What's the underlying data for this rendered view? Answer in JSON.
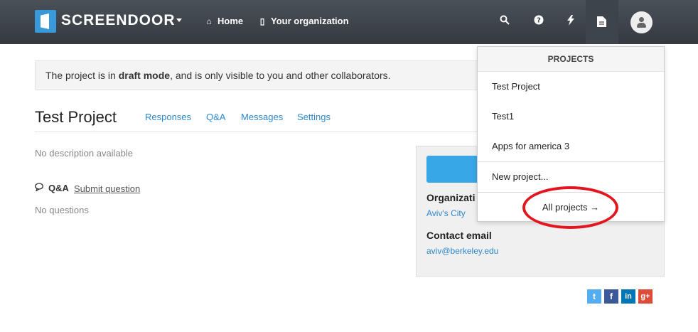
{
  "header": {
    "brand": "SCREENDOOR",
    "nav": [
      {
        "label": "Home",
        "icon": "home-icon"
      },
      {
        "label": "Your organization",
        "icon": "building-icon"
      }
    ],
    "right_icons": [
      "search-icon",
      "question-icon",
      "lightning-icon",
      "document-icon",
      "user-icon"
    ]
  },
  "notice": {
    "pre": "The project is in ",
    "bold": "draft mode",
    "post": ", and is only visible to you and other collaborators."
  },
  "project": {
    "title": "Test Project",
    "tabs": [
      "Responses",
      "Q&A",
      "Messages",
      "Settings"
    ],
    "description": "No description available",
    "qa_heading": "Q&A",
    "submit_question": "Submit question",
    "no_questions": "No questions"
  },
  "sidebar": {
    "org_label": "Organizati",
    "org_value": "Aviv's City",
    "email_label": "Contact email",
    "email_value": "aviv@berkeley.edu"
  },
  "dropdown": {
    "header": "PROJECTS",
    "items": [
      "Test Project",
      "Test1",
      "Apps for america 3"
    ],
    "new_project": "New project...",
    "all_projects": "All projects →"
  },
  "social": [
    {
      "icon": "twitter-icon",
      "glyph": "t",
      "color": "#55acee"
    },
    {
      "icon": "facebook-icon",
      "glyph": "f",
      "color": "#3b5998"
    },
    {
      "icon": "linkedin-icon",
      "glyph": "in",
      "color": "#0077b5"
    },
    {
      "icon": "googleplus-icon",
      "glyph": "g+",
      "color": "#dd4b39"
    }
  ],
  "colors": {
    "topbar": "#3e444b",
    "accent": "#2e87c8",
    "button": "#37a7e8",
    "highlight": "#e3151f"
  }
}
